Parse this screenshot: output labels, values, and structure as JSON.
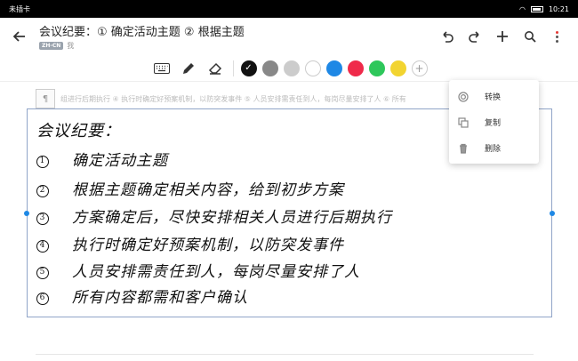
{
  "statusbar": {
    "carrier": "未插卡",
    "time": "10:21"
  },
  "appbar": {
    "title": "会议纪要：① 确定活动主题 ② 根据主题",
    "lang_badge": "ZH-CN",
    "owner": "我"
  },
  "toolbar": {
    "swatches": [
      "#111111",
      "#888888",
      "#cccccc",
      "#ffffff",
      "#1e88e5",
      "#ef2a4a",
      "#2ec75b",
      "#f2d430"
    ]
  },
  "background_text": "组进行后期执行 ④ 执行时确定好预案机制，以防突发事件 ⑤ 人员安排需责任到人，每岗尽量安排了人 ⑥ 所有",
  "handwriting": {
    "title": "会议纪要：",
    "lines": [
      {
        "num": "1",
        "text": "确定活动主题"
      },
      {
        "num": "2",
        "text": "根据主题确定相关内容，给到初步方案"
      },
      {
        "num": "3",
        "text": "方案确定后，尽快安排相关人员进行后期执行"
      },
      {
        "num": "4",
        "text": "执行时确定好预案机制，以防突发事件"
      },
      {
        "num": "5",
        "text": "人员安排需责任到人，每岗尽量安排了人"
      },
      {
        "num": "6",
        "text": "所有内容都需和客户确认"
      }
    ]
  },
  "context_menu": {
    "items": [
      {
        "label": "转换",
        "icon": "convert-icon"
      },
      {
        "label": "复制",
        "icon": "copy-icon"
      },
      {
        "label": "删除",
        "icon": "trash-icon"
      }
    ]
  }
}
